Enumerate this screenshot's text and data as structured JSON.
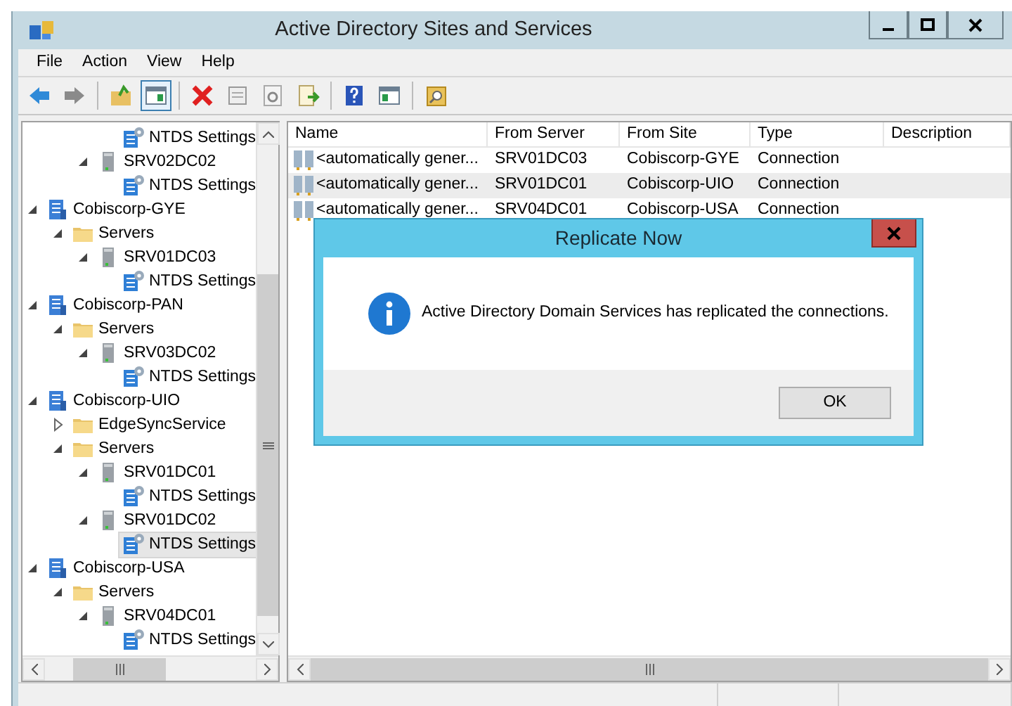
{
  "window": {
    "title": "Active Directory Sites and Services"
  },
  "menu": [
    "File",
    "Action",
    "View",
    "Help"
  ],
  "toolbar": [
    {
      "kind": "back",
      "pressed": false
    },
    {
      "kind": "forward",
      "pressed": false
    },
    {
      "kind": "separator"
    },
    {
      "kind": "up",
      "pressed": false
    },
    {
      "kind": "tree-toggle",
      "pressed": true
    },
    {
      "kind": "separator"
    },
    {
      "kind": "delete",
      "pressed": false
    },
    {
      "kind": "properties",
      "pressed": false
    },
    {
      "kind": "refresh",
      "pressed": false
    },
    {
      "kind": "export",
      "pressed": false
    },
    {
      "kind": "separator"
    },
    {
      "kind": "help",
      "pressed": false
    },
    {
      "kind": "action-pane",
      "pressed": false
    },
    {
      "kind": "separator"
    },
    {
      "kind": "find",
      "pressed": false
    }
  ],
  "tree": [
    {
      "children": [
        {
          "children": [
            {
              "children": [
                {
                  "kind": "ntds",
                  "label": "NTDS Settings",
                  "selected": false
                }
              ]
            },
            {
              "kind": "server",
              "label": "SRV02DC02",
              "expanded": true,
              "selected": false,
              "children": [
                {
                  "kind": "ntds",
                  "label": "NTDS Settings",
                  "selected": false
                }
              ]
            }
          ]
        }
      ]
    },
    {
      "kind": "site",
      "label": "Cobiscorp-GYE",
      "expanded": true,
      "selected": false,
      "children": [
        {
          "kind": "folder",
          "label": "Servers",
          "expanded": true,
          "selected": false,
          "children": [
            {
              "kind": "server",
              "label": "SRV01DC03",
              "expanded": true,
              "selected": false,
              "children": [
                {
                  "kind": "ntds",
                  "label": "NTDS Settings",
                  "selected": false
                }
              ]
            }
          ]
        }
      ]
    },
    {
      "kind": "site",
      "label": "Cobiscorp-PAN",
      "expanded": true,
      "selected": false,
      "children": [
        {
          "kind": "folder",
          "label": "Servers",
          "expanded": true,
          "selected": false,
          "children": [
            {
              "kind": "server",
              "label": "SRV03DC02",
              "expanded": true,
              "selected": false,
              "children": [
                {
                  "kind": "ntds",
                  "label": "NTDS Settings",
                  "selected": false
                }
              ]
            }
          ]
        }
      ]
    },
    {
      "kind": "site",
      "label": "Cobiscorp-UIO",
      "expanded": true,
      "selected": false,
      "children": [
        {
          "kind": "folder",
          "label": "EdgeSyncService",
          "expanded": false,
          "selected": false
        },
        {
          "kind": "folder",
          "label": "Servers",
          "expanded": true,
          "selected": false,
          "children": [
            {
              "kind": "server",
              "label": "SRV01DC01",
              "expanded": true,
              "selected": false,
              "children": [
                {
                  "kind": "ntds",
                  "label": "NTDS Settings",
                  "selected": false
                }
              ]
            },
            {
              "kind": "server",
              "label": "SRV01DC02",
              "expanded": true,
              "selected": false,
              "children": [
                {
                  "kind": "ntds",
                  "label": "NTDS Settings",
                  "selected": true
                }
              ]
            }
          ]
        }
      ]
    },
    {
      "kind": "site",
      "label": "Cobiscorp-USA",
      "expanded": true,
      "selected": false,
      "children": [
        {
          "kind": "folder",
          "label": "Servers",
          "expanded": true,
          "selected": false,
          "children": [
            {
              "kind": "server",
              "label": "SRV04DC01",
              "expanded": true,
              "selected": false,
              "children": [
                {
                  "kind": "ntds",
                  "label": "NTDS Settings",
                  "selected": false
                }
              ]
            }
          ]
        }
      ]
    }
  ],
  "list": {
    "columns": [
      "Name",
      "From Server",
      "From Site",
      "Type",
      "Description"
    ],
    "rows": [
      {
        "cells": [
          "<automatically gener...",
          "SRV01DC03",
          "Cobiscorp-GYE",
          "Connection"
        ],
        "selected": false
      },
      {
        "cells": [
          "<automatically gener...",
          "SRV01DC01",
          "Cobiscorp-UIO",
          "Connection"
        ],
        "selected": true
      },
      {
        "cells": [
          "<automatically gener...",
          "SRV04DC01",
          "Cobiscorp-USA",
          "Connection"
        ],
        "selected": false
      }
    ]
  },
  "dialog": {
    "title": "Replicate Now",
    "message": "Active Directory Domain Services has replicated the connections.",
    "buttons": [
      "OK"
    ]
  }
}
